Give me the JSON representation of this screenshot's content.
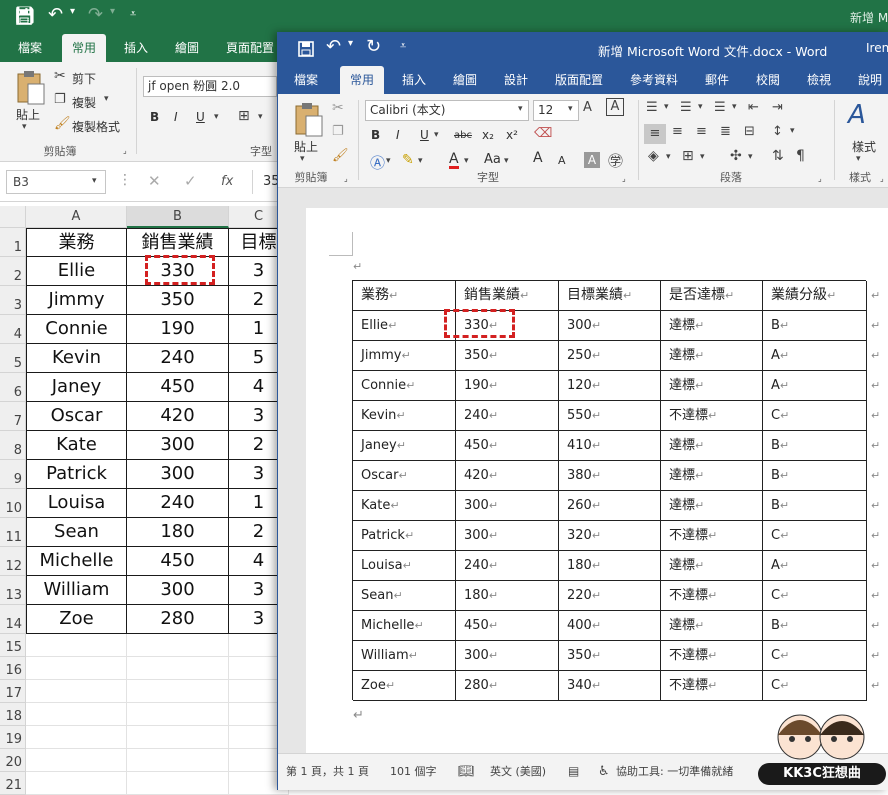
{
  "excel": {
    "qat_icons": [
      "save-icon",
      "undo-icon",
      "redo-icon",
      "customize-icon"
    ],
    "title_partial": "新增 M",
    "tabs": [
      "檔案",
      "常用",
      "插入",
      "繪圖",
      "頁面配置"
    ],
    "active_tab": "常用",
    "ribbon": {
      "paste_label": "貼上",
      "cut_label": "剪下",
      "copy_label": "複製",
      "format_painter_label": "複製格式",
      "clipboard_group": "剪貼簿",
      "font_name": "jf open 粉圓 2.0",
      "bold": "B",
      "italic": "I",
      "underline": "U",
      "font_group_partial": "字型"
    },
    "name_box": "B3",
    "fx": "fx",
    "formula_partial": "35",
    "columns": [
      "A",
      "B",
      "C"
    ],
    "rows": [
      [
        "業務",
        "銷售業績",
        "目標"
      ],
      [
        "Ellie",
        "330",
        "3"
      ],
      [
        "Jimmy",
        "350",
        "2"
      ],
      [
        "Connie",
        "190",
        "1"
      ],
      [
        "Kevin",
        "240",
        "5"
      ],
      [
        "Janey",
        "450",
        "4"
      ],
      [
        "Oscar",
        "420",
        "3"
      ],
      [
        "Kate",
        "300",
        "2"
      ],
      [
        "Patrick",
        "300",
        "3"
      ],
      [
        "Louisa",
        "240",
        "1"
      ],
      [
        "Sean",
        "180",
        "2"
      ],
      [
        "Michelle",
        "450",
        "4"
      ],
      [
        "William",
        "300",
        "3"
      ],
      [
        "Zoe",
        "280",
        "3"
      ]
    ],
    "row_numbers": [
      "1",
      "2",
      "3",
      "4",
      "5",
      "6",
      "7",
      "8",
      "9",
      "10",
      "11",
      "12",
      "13",
      "14",
      "15",
      "16",
      "17",
      "18",
      "19",
      "20",
      "21"
    ]
  },
  "word": {
    "title": "新增 Microsoft Word 文件.docx - Word",
    "user_partial": "Irene",
    "tabs": [
      "檔案",
      "常用",
      "插入",
      "繪圖",
      "設計",
      "版面配置",
      "參考資料",
      "郵件",
      "校閱",
      "檢視",
      "說明"
    ],
    "active_tab": "常用",
    "ribbon": {
      "paste_label": "貼上",
      "clipboard_group": "剪貼簿",
      "font_name": "Calibri (本文)",
      "font_size": "12",
      "font_group": "字型",
      "paragraph_group": "段落",
      "styles_label": "樣式",
      "styles_group": "樣式",
      "bold": "B",
      "italic": "I",
      "underline": "U",
      "strike": "abc",
      "subscript": "x₂",
      "superscript": "x²",
      "font_color": "A",
      "case": "Aa",
      "grow": "A",
      "shrink": "A"
    },
    "table": {
      "header": [
        "業務",
        "銷售業績",
        "目標業績",
        "是否達標",
        "業績分級"
      ],
      "rows": [
        [
          "Ellie",
          "330",
          "300",
          "達標",
          "B"
        ],
        [
          "Jimmy",
          "350",
          "250",
          "達標",
          "A"
        ],
        [
          "Connie",
          "190",
          "120",
          "達標",
          "A"
        ],
        [
          "Kevin",
          "240",
          "550",
          "不達標",
          "C"
        ],
        [
          "Janey",
          "450",
          "410",
          "達標",
          "B"
        ],
        [
          "Oscar",
          "420",
          "380",
          "達標",
          "B"
        ],
        [
          "Kate",
          "300",
          "260",
          "達標",
          "B"
        ],
        [
          "Patrick",
          "300",
          "320",
          "不達標",
          "C"
        ],
        [
          "Louisa",
          "240",
          "180",
          "達標",
          "A"
        ],
        [
          "Sean",
          "180",
          "220",
          "不達標",
          "C"
        ],
        [
          "Michelle",
          "450",
          "400",
          "達標",
          "B"
        ],
        [
          "William",
          "300",
          "350",
          "不達標",
          "C"
        ],
        [
          "Zoe",
          "280",
          "340",
          "不達標",
          "C"
        ]
      ]
    },
    "para_mark": "↵",
    "status": {
      "page": "第 1 頁，共 1 頁",
      "words": "101 個字",
      "lang": "英文 (美國)",
      "accessibility": "協助工具: 一切準備就緒"
    }
  },
  "watermark": "KK3C狂想曲",
  "colors": {
    "excel_green": "#217346",
    "word_blue": "#2b579a",
    "highlight_red": "#d32020"
  }
}
